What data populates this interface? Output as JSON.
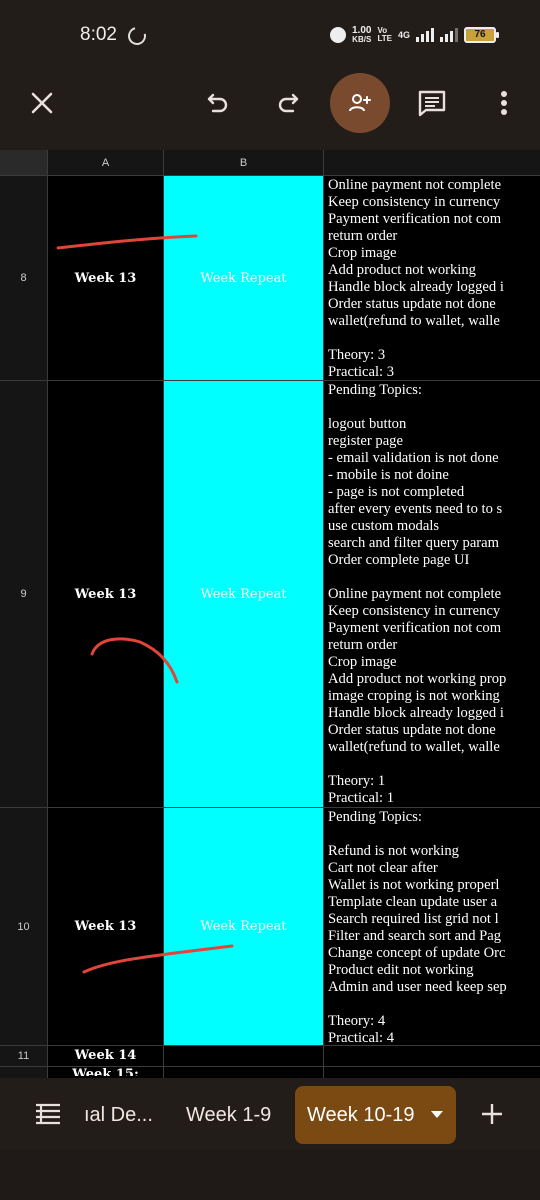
{
  "status_bar": {
    "time": "8:02",
    "speed_value": "1.00",
    "speed_unit": "KB/S",
    "volte_top": "Vo",
    "volte_bottom": "LTE",
    "network": "4G",
    "battery": "76"
  },
  "toolbar": {
    "close_icon": "close-icon",
    "undo_icon": "undo-icon",
    "redo_icon": "redo-icon",
    "share_icon": "add-person-icon",
    "comment_icon": "comment-icon",
    "more_icon": "more-vert-icon",
    "accent": "#7a4a2e"
  },
  "sheet": {
    "columns": [
      "A",
      "B"
    ],
    "rows": [
      {
        "number": "8",
        "week": "Week 13",
        "status": "Week Repeat",
        "notes": [
          "Online payment not complete",
          "Keep consistency in currency",
          "Payment verification not com",
          "return order",
          "Crop image",
          "Add product not working",
          "Handle block already logged i",
          "Order status update not done",
          "wallet(refund to wallet, walle",
          "",
          "Theory: 3",
          "Practical: 3"
        ]
      },
      {
        "number": "9",
        "week": "Week 13",
        "status": "Week Repeat",
        "notes": [
          "Pending Topics:",
          "",
          "logout button",
          "register page",
          "- email validation is not done",
          "- mobile is not doine",
          "-  page is not completed",
          "after every events need to to s",
          "use custom modals",
          "search and filter query param",
          "Order complete page UI",
          "",
          "Online payment not complete",
          "Keep consistency in currency",
          "Payment verification not com",
          "return order",
          "Crop image",
          "Add product not working prop",
          "image croping is not working",
          "Handle block already logged i",
          "Order status update not done",
          "wallet(refund to wallet, walle",
          "",
          "Theory: 1",
          "Practical: 1"
        ]
      },
      {
        "number": "10",
        "week": "Week 13",
        "status": "Week Repeat",
        "notes": [
          "Pending Topics:",
          "",
          "Refund is not working",
          "Cart not clear after",
          "Wallet is not working properl",
          "Template clean update  user a",
          "Search required list grid not l",
          "Filter and search sort and Pag",
          "Change concept of update Orc",
          "Product edit not working",
          "Admin and user need keep sep",
          "",
          "Theory: 4",
          "Practical: 4"
        ]
      },
      {
        "number": "11",
        "week": "Week 14"
      },
      {
        "number": "",
        "week": "Week 15:"
      }
    ],
    "colors": {
      "status_fill": "#00ffff",
      "annotation_ink": "#e0453a"
    }
  },
  "tabs": {
    "all_sheets_icon": "sheets-list-icon",
    "items": [
      "ıal De...",
      "Week 1-9",
      "Week 10-19"
    ],
    "active_index": 2,
    "active_color": "#7a4a12",
    "add_icon": "plus-icon"
  }
}
